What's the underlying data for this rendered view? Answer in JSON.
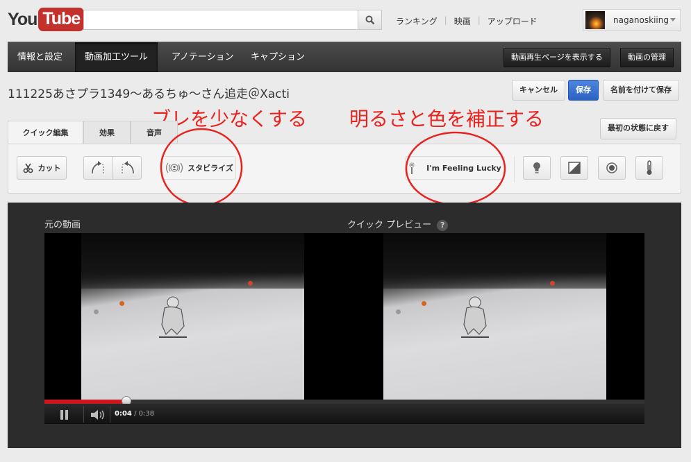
{
  "masthead": {
    "logo_you": "You",
    "logo_tube": "Tube",
    "search_placeholder": "",
    "nav": [
      "ランキング",
      "映画",
      "アップロード"
    ],
    "username": "naganoskiing"
  },
  "tabbar": {
    "tabs": [
      "情報と設定",
      "動画加工ツール",
      "アノテーション",
      "キャプション"
    ],
    "active_tab": "動画加工ツール",
    "view_page_btn": "動画再生ページを表示する",
    "manage_btn": "動画の管理"
  },
  "title_row": {
    "video_title": "111225あさプラ1349～あるちゅ～さん追走＠Xacti",
    "cancel": "キャンセル",
    "save": "保存",
    "save_as": "名前を付けて保存",
    "reset": "最初の状態に戻す"
  },
  "annotations": {
    "stabilize_note": "ブレを少なくする",
    "color_note": "明るさと色を補正する"
  },
  "edit_tabs": [
    "クイック編集",
    "効果",
    "音声"
  ],
  "tools": {
    "cut": "カット",
    "stabilize": "スタビライズ",
    "lucky": "I'm Feeling Lucky"
  },
  "preview": {
    "original_label": "元の動画",
    "preview_label": "クイック プレビュー",
    "help": "?",
    "time_current": "0:04",
    "time_total": "/ 0:38",
    "progress": 0.136
  },
  "colors": {
    "accent_red": "#e8231f",
    "save_blue": "#2b62c2",
    "youtube_red": "#c4302b"
  }
}
